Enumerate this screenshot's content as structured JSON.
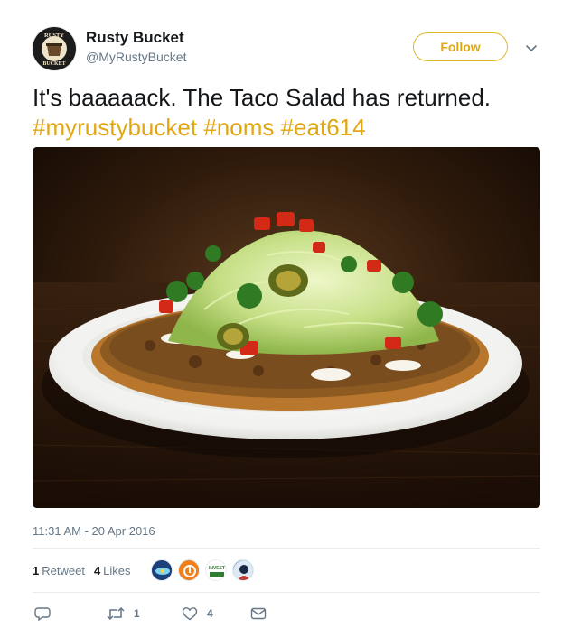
{
  "user": {
    "display_name": "Rusty Bucket",
    "screen_name": "@MyRustyBucket",
    "avatar_icon": "rusty-bucket-logo",
    "avatar_text_top": "RUSTY",
    "avatar_text_bottom": "BUCKET"
  },
  "follow_label": "Follow",
  "tweet": {
    "text": "It's baaaaack. The Taco Salad has returned.",
    "hashtags": [
      "#myrustybucket",
      "#noms",
      "#eat614"
    ]
  },
  "media": {
    "icon": "taco-salad-photo"
  },
  "timestamp": "11:31 AM - 20 Apr 2016",
  "stats": {
    "retweets_count": "1",
    "retweets_label": "Retweet",
    "likes_count": "4",
    "likes_label": "Likes",
    "likers": [
      {
        "icon": "liker-avatar-1",
        "color": "#1d3f7a"
      },
      {
        "icon": "liker-avatar-2",
        "color": "#f07f1d"
      },
      {
        "icon": "liker-avatar-3",
        "color": "#ffffff"
      },
      {
        "icon": "liker-avatar-4",
        "color": "#2b6cb0"
      }
    ],
    "liker3_text": "INVEST"
  },
  "actions": {
    "reply_icon": "reply-icon",
    "retweet_icon": "retweet-icon",
    "retweet_count": "1",
    "like_icon": "heart-icon",
    "like_count": "4",
    "dm_icon": "envelope-icon"
  },
  "colors": {
    "accent": "#e0a711",
    "text": "#14171a",
    "secondary": "#657786",
    "divider": "#e6ecf0"
  }
}
